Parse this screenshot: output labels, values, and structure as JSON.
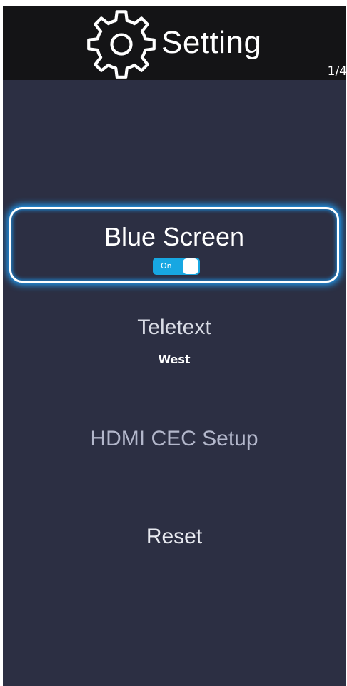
{
  "header": {
    "title": "Setting",
    "icon": "gear-icon",
    "page_indicator": "1/4"
  },
  "menu": {
    "items": [
      {
        "label": "Blue Screen",
        "toggle_label": "On",
        "selected": true
      },
      {
        "label": "Teletext",
        "value": "West"
      },
      {
        "label": "HDMI CEC Setup"
      },
      {
        "label": "Reset"
      }
    ]
  },
  "colors": {
    "background": "#2c2f43",
    "header": "#141416",
    "selection_glow": "#1fa3ff",
    "toggle_on": "#17a7e2"
  }
}
